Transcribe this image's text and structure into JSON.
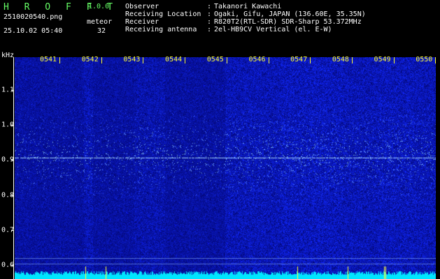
{
  "app": {
    "title": "H R O F F T",
    "version": "1.0.0"
  },
  "file": {
    "name": "2510020540.png",
    "datetime": "25.10.02 05:40"
  },
  "counter": {
    "label": "meteor",
    "value": "32"
  },
  "meta": [
    {
      "label": "Observer",
      "value": "Takanori Kawachi"
    },
    {
      "label": "Receiving Location",
      "value": "Ogaki, Gifu, JAPAN (136.60E, 35.35N)"
    },
    {
      "label": "Receiver",
      "value": "R820T2(RTL-SDR) SDR-Sharp 53.372MHz"
    },
    {
      "label": "Receiving antenna",
      "value": "2el-HB9CV Vertical (el. E-W)"
    }
  ],
  "meta_separator": ":",
  "axis": {
    "unit": "kHz",
    "time_labels": [
      "0541",
      "0542",
      "0543",
      "0544",
      "0545",
      "0546",
      "0547",
      "0548",
      "0549",
      "0550"
    ],
    "freq_labels": [
      "1.1",
      "1.0",
      "0.9",
      "0.8",
      "0.7",
      "0.6"
    ]
  },
  "colors": {
    "background": "#000000",
    "spectrum_base": "#00007a",
    "signal": "#5a8cff",
    "carrier": "#9fd0ff",
    "noise_floor": "#00e5ff",
    "tick_marks": "#ffff33",
    "title": "#66ff66"
  }
}
